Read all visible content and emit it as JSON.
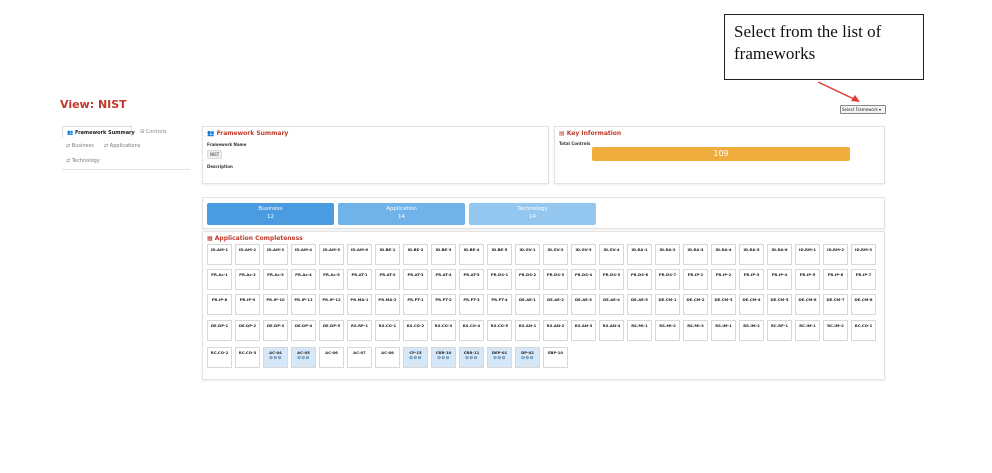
{
  "callout": {
    "text": "Select from the list of frameworks"
  },
  "view": {
    "title": "View: NIST"
  },
  "framework_select": {
    "label": "Select Framework ▾"
  },
  "sidebar": {
    "tabs": [
      {
        "label": "Framework Summary",
        "icon": "users-icon"
      },
      {
        "label": "Controls",
        "icon": "grid-icon"
      }
    ],
    "links": [
      {
        "label": "Business",
        "icon": "shuffle-icon"
      },
      {
        "label": "Applications",
        "icon": "shuffle-icon"
      },
      {
        "label": "Technology",
        "icon": "shuffle-icon"
      }
    ]
  },
  "framework_summary": {
    "title": "Framework Summary",
    "name_label": "Framework Name",
    "name_value": "NIST",
    "description_label": "Description"
  },
  "key_information": {
    "title": "Key Information",
    "total_controls_label": "Total Controls",
    "total_controls_value": "109",
    "bar_color": "#f0ad3e"
  },
  "categories": [
    {
      "label": "Business",
      "count": "12",
      "color": "#4a9be0"
    },
    {
      "label": "Application",
      "count": "14",
      "color": "#6fb3ea"
    },
    {
      "label": "Technology",
      "count": "14",
      "color": "#93c7ef"
    }
  ],
  "completeness": {
    "title": "Application Completeness",
    "rows": [
      [
        "ID.AM-1",
        "ID.AM-2",
        "ID.AM-3",
        "ID.AM-4",
        "ID.AM-5",
        "ID.AM-6",
        "ID.BE-1",
        "ID.BE-2",
        "ID.BE-3",
        "ID.BE-4",
        "ID.BE-5",
        "ID.GV-1",
        "ID.GV-2",
        "ID.GV-3",
        "ID.GV-4",
        "ID.RA-1",
        "ID.RA-2",
        "ID.RA-3",
        "ID.RA-4",
        "ID.RA-5",
        "ID.RA-6",
        "ID.RM-1",
        "ID.RM-2",
        "ID.RM-3"
      ],
      [
        "PR.Ac-1",
        "PR.Ac-2",
        "PR.Ac-3",
        "PR.Ac-4",
        "PR.Ac-5",
        "PR.AT-1",
        "PR.AT-2",
        "PR.AT-3",
        "PR.AT-4",
        "PR.AT-5",
        "PR.DS-1",
        "PR.DS-2",
        "PR.DS-3",
        "PR.DS-4",
        "PR.DS-5",
        "PR.DS-6",
        "PR.DS-7",
        "PR.IP-1",
        "PR.IP-2",
        "PR.IP-3",
        "PR.IP-4",
        "PR.IP-5",
        "PR.IP-6",
        "PR.IP-7"
      ],
      [
        "PR.IP-8",
        "PR.IP-9",
        "PR.IP-10",
        "PR.IP-11",
        "PR.IP-12",
        "PR.MA-1",
        "PR.MA-2",
        "PR.PT-1",
        "PR.PT-2",
        "PR.PT-3",
        "PR.PT-4",
        "DE.AE-1",
        "DE.AE-2",
        "DE.AE-3",
        "DE.AE-4",
        "DE.AE-5",
        "DE.CM-1",
        "DE.CM-2",
        "DE.CM-3",
        "DE.CM-4",
        "DE.CM-5",
        "DE.CM-6",
        "DE.CM-7",
        "DE.CM-8"
      ],
      [
        "DE.DP-1",
        "DE.DP-2",
        "DE.DP-3",
        "DE.DP-4",
        "DE.DP-5",
        "RS.RP-1",
        "RS.CO-1",
        "RS.CO-2",
        "RS.CO-3",
        "RS.CO-4",
        "RS.CO-5",
        "RS.AN-1",
        "RS.AN-2",
        "RS.AN-3",
        "RS.AN-4",
        "RS.MI-1",
        "RS.MI-2",
        "RS.MI-3",
        "RS.IM-1",
        "RS.IM-2",
        "RC.RP-1",
        "RC.IM-1",
        "RC.IM-2",
        "RC.CO-1"
      ],
      [
        "RC.CO-2",
        "RC.CO-3",
        "AC-04",
        "AC-05",
        "AC-06",
        "AC-07",
        "AC-08",
        "CP-15",
        "CRR-10",
        "CRR-11",
        "DEP-01",
        "DP-02",
        "EBP-10"
      ]
    ],
    "highlighted": [
      "AC-04",
      "AC-05",
      "CP-15",
      "CRR-10",
      "CRR-11",
      "DEP-01",
      "DP-02"
    ],
    "marker_text": "⊖⊖⊖",
    "highlight_color": "#d6e8f7"
  }
}
